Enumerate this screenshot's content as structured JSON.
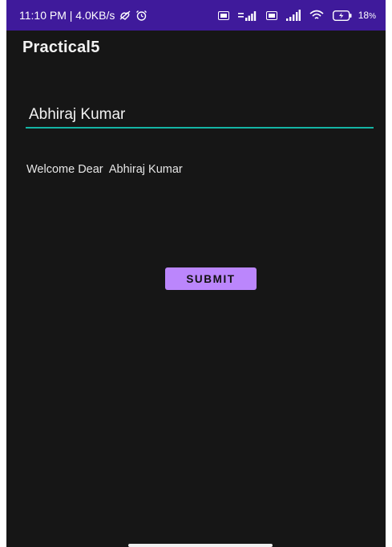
{
  "status_bar": {
    "time_text": "11:10 PM | 4.0KB/s",
    "battery_level": "18",
    "battery_suffix": "%",
    "icons": [
      "no-data-saver-icon",
      "alarm-icon",
      "volte-icon",
      "signal-4g-icon",
      "volte-icon",
      "signal-icon",
      "wifi-icon",
      "battery-icon"
    ]
  },
  "app_bar": {
    "title": "Practical5"
  },
  "form": {
    "name_value": "Abhiraj Kumar",
    "welcome_text": "Welcome Dear  Abhiraj Kumar",
    "submit_label": "SUBMIT"
  },
  "colors": {
    "status_bar": "#3f1a9b",
    "background": "#161616",
    "accent_underline": "#14b4a4",
    "button": "#bb86fc"
  }
}
